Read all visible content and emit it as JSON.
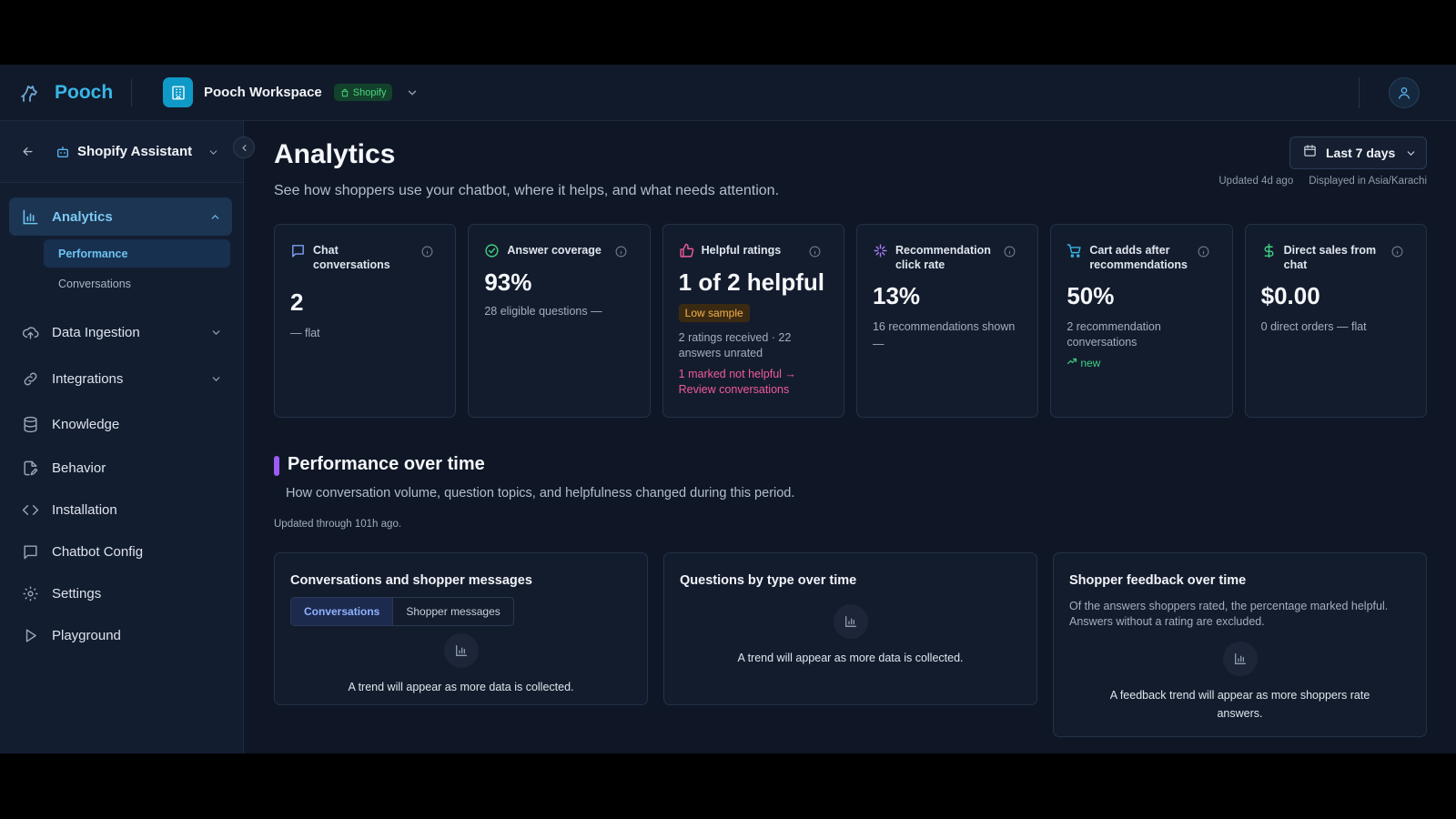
{
  "brand": {
    "name": "Pooch"
  },
  "workspace": {
    "name": "Pooch Workspace",
    "platform_badge": "Shopify"
  },
  "sidebar": {
    "assistant": "Shopify Assistant",
    "items": [
      {
        "label": "Analytics",
        "icon": "bar-chart-icon",
        "subitems": [
          "Performance",
          "Conversations"
        ]
      },
      {
        "label": "Data Ingestion",
        "icon": "cloud-upload-icon"
      },
      {
        "label": "Integrations",
        "icon": "link-icon"
      },
      {
        "label": "Knowledge",
        "icon": "database-icon"
      },
      {
        "label": "Behavior",
        "icon": "file-edit-icon"
      },
      {
        "label": "Installation",
        "icon": "code-icon"
      },
      {
        "label": "Chatbot Config",
        "icon": "message-square-icon"
      },
      {
        "label": "Settings",
        "icon": "gear-icon"
      },
      {
        "label": "Playground",
        "icon": "play-icon"
      }
    ]
  },
  "header": {
    "title": "Analytics",
    "subtitle": "See how shoppers use your chatbot, where it helps, and what needs attention.",
    "date_range": "Last 7 days",
    "updated": "Updated 4d ago",
    "timezone": "Displayed in Asia/Karachi"
  },
  "cards": [
    {
      "label": "Chat conversations",
      "value": "2",
      "sub": "— flat"
    },
    {
      "label": "Answer coverage",
      "value": "93%",
      "sub": "28 eligible questions —"
    },
    {
      "label": "Helpful ratings",
      "value": "1 of 2 helpful",
      "badge": "Low sample",
      "sub": "2 ratings received · 22 answers unrated",
      "link": "1 marked not helpful → Review conversations"
    },
    {
      "label": "Recommendation click rate",
      "value": "13%",
      "sub": "16 recommendations shown",
      "sub2": "—"
    },
    {
      "label": "Cart adds after recommendations",
      "value": "50%",
      "sub": "2 recommendation conversations",
      "trend": "new"
    },
    {
      "label": "Direct sales from chat",
      "value": "$0.00",
      "sub": "0 direct orders — flat"
    }
  ],
  "section": {
    "title": "Performance over time",
    "desc": "How conversation volume, question topics, and helpfulness changed during this period.",
    "updated": "Updated through 101h ago."
  },
  "panels": [
    {
      "title": "Conversations and shopper messages",
      "tabs": [
        "Conversations",
        "Shopper messages"
      ],
      "empty": "A trend will appear as more data is collected."
    },
    {
      "title": "Questions by type over time",
      "empty": "A trend will appear as more data is collected."
    },
    {
      "title": "Shopper feedback over time",
      "desc": "Of the answers shoppers rated, the percentage marked helpful. Answers without a rating are excluded.",
      "empty": "A feedback trend will appear as more shoppers rate answers."
    }
  ],
  "colors": {
    "accent": "#38b6e8",
    "section_bar": "#9b5cf6",
    "success": "#3fcf83",
    "warning": "#f3b34a",
    "danger": "#ef5a9a"
  }
}
